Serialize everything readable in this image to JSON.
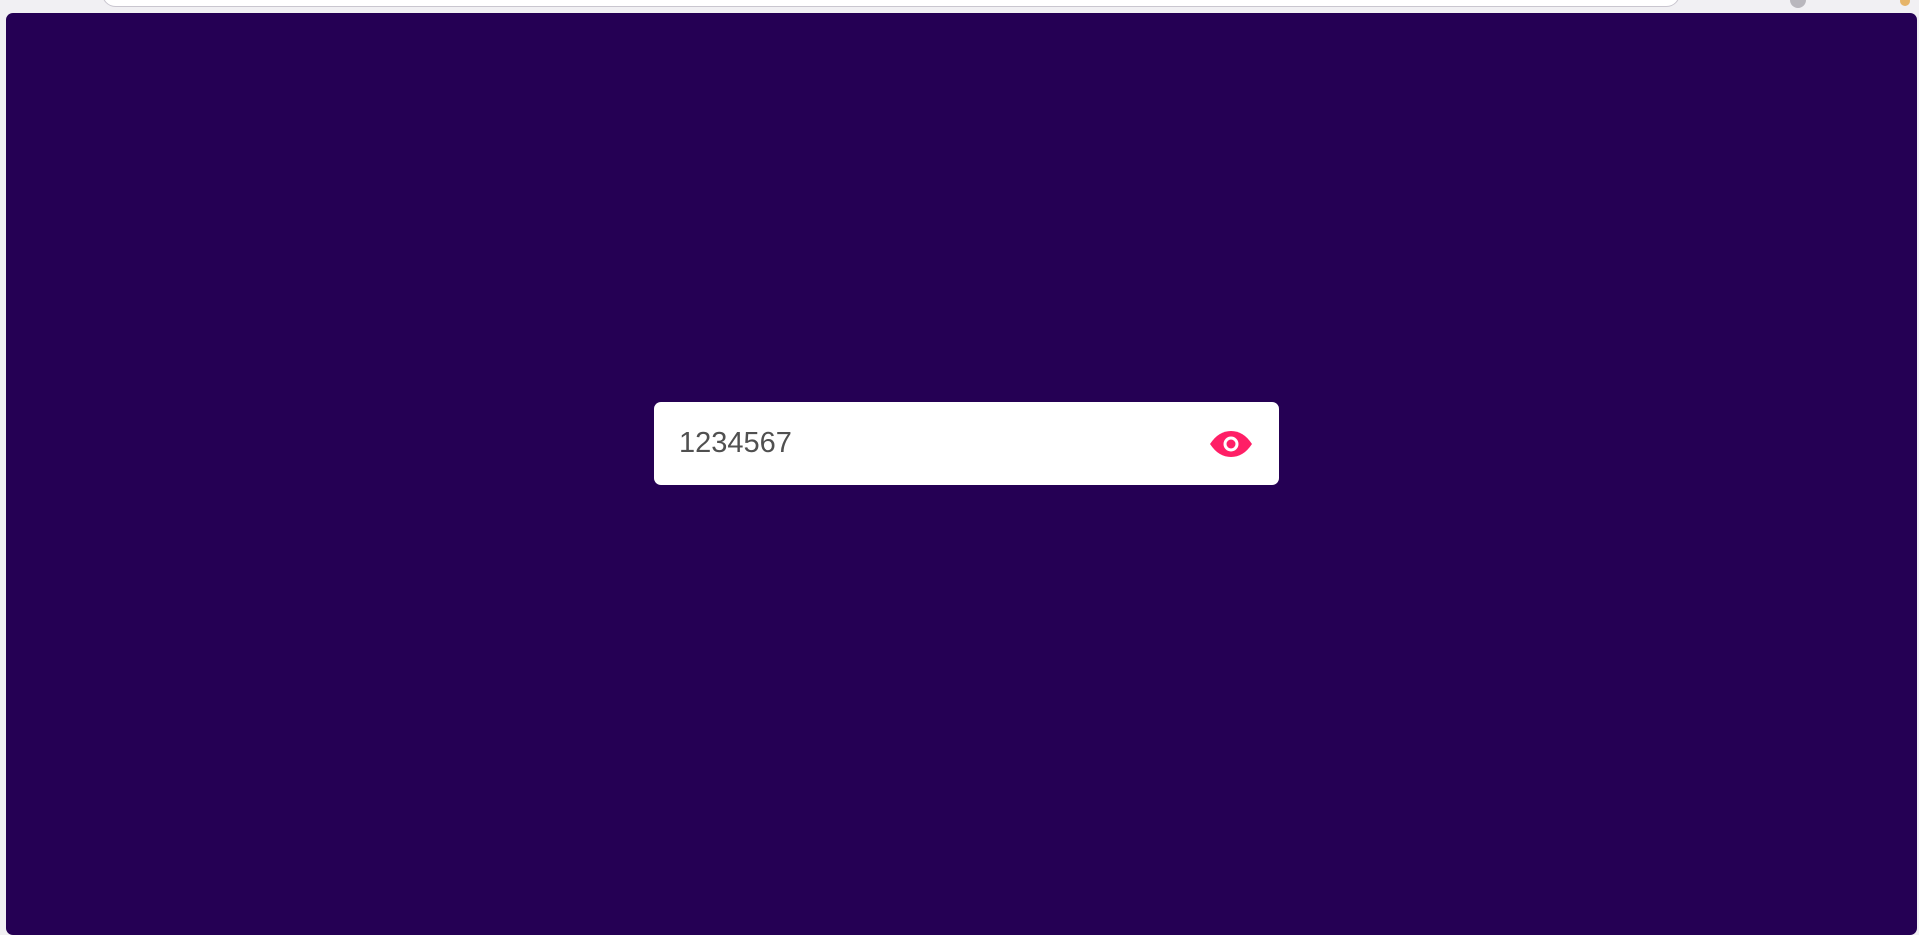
{
  "theme": {
    "background": "#250054",
    "accent": "#ff1f66",
    "field_background": "#ffffff",
    "text_color": "#505050"
  },
  "password_field": {
    "value": "1234567",
    "toggle_icon": "eye-icon"
  }
}
